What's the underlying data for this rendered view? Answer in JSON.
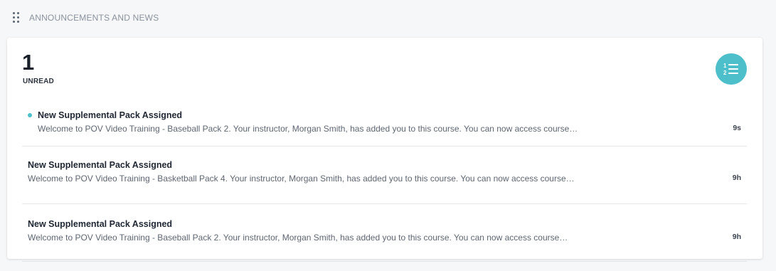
{
  "section": {
    "title": "ANNOUNCEMENTS AND NEWS",
    "drag_handle_icon": "drag-handle-icon"
  },
  "summary": {
    "count": "1",
    "label": "UNREAD"
  },
  "sort_button": {
    "icon": "numbered-list-icon",
    "color": "#4dbfca"
  },
  "announcements": [
    {
      "title": "New Supplemental Pack Assigned",
      "body": "Welcome to POV Video Training - Baseball Pack 2. Your instructor, Morgan Smith, has added you to this course. You can now access course…",
      "time": "9s",
      "unread": true
    },
    {
      "title": "New Supplemental Pack Assigned",
      "body": "Welcome to POV Video Training - Basketball Pack 4. Your instructor, Morgan Smith, has added you to this course. You can now access course…",
      "time": "9h",
      "unread": false
    },
    {
      "title": "New Supplemental Pack Assigned",
      "body": "Welcome to POV Video Training - Baseball Pack 2. Your instructor, Morgan Smith, has added you to this course. You can now access course…",
      "time": "9h",
      "unread": false
    }
  ],
  "colors": {
    "accent": "#4dbfca",
    "background": "#f6f7f9",
    "card": "#ffffff"
  }
}
